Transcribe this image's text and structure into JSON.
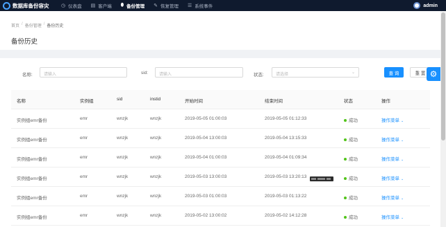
{
  "brand": {
    "name": "数据库备份容灾"
  },
  "nav": [
    {
      "label": "仪表盘",
      "icon": "dashboard-icon",
      "glyph": "◷"
    },
    {
      "label": "客户端",
      "icon": "client-icon",
      "glyph": "▤"
    },
    {
      "label": "备份管理",
      "icon": "backup-icon",
      "glyph": "⬮"
    },
    {
      "label": "恢复管理",
      "icon": "restore-icon",
      "glyph": "✎"
    },
    {
      "label": "系统事件",
      "icon": "events-icon",
      "glyph": "☰"
    }
  ],
  "active_nav": "备份管理",
  "user": {
    "name": "admin"
  },
  "breadcrumb": [
    "首页",
    "备份管理",
    "备份历史"
  ],
  "page_title": "备份历史",
  "filters": {
    "name_label": "名称:",
    "name_placeholder": "请输入",
    "sid_label": "sid:",
    "sid_placeholder": "请输入",
    "status_label": "状态:",
    "status_placeholder": "请选择",
    "query_label": "查 询",
    "reset_label": "重 置"
  },
  "table": {
    "columns": [
      "名称",
      "实例组",
      "sid",
      "instid",
      "开始时间",
      "结束时间",
      "状态",
      "操作"
    ],
    "rows": [
      {
        "name": "实例组emr备份",
        "group": "emr",
        "sid": "wnzjk",
        "instid": "wnzjk",
        "start": "2019-05-05 01:00:03",
        "end": "2019-05-05 01:12:33",
        "status": "成功",
        "op": "操作菜单"
      },
      {
        "name": "实例组emr备份",
        "group": "emr",
        "sid": "wnzjk",
        "instid": "wnzjk",
        "start": "2019-05-04 13:00:03",
        "end": "2019-05-04 13:15:33",
        "status": "成功",
        "op": "操作菜单"
      },
      {
        "name": "实例组emr备份",
        "group": "emr",
        "sid": "wnzjk",
        "instid": "wnzjk",
        "start": "2019-05-04 01:00:03",
        "end": "2019-05-04 01:09:34",
        "status": "成功",
        "op": "操作菜单"
      },
      {
        "name": "实例组emr备份",
        "group": "emr",
        "sid": "wnzjk",
        "instid": "wnzjk",
        "start": "2019-05-03 13:00:03",
        "end": "2019-05-03 13:20:13",
        "status": "成功",
        "op": "操作菜单"
      },
      {
        "name": "实例组emr备份",
        "group": "emr",
        "sid": "wnzjk",
        "instid": "wnzjk",
        "start": "2019-05-03 01:00:03",
        "end": "2019-05-03 01:13:22",
        "status": "成功",
        "op": "操作菜单"
      },
      {
        "name": "实例组emr备份",
        "group": "emr",
        "sid": "wnzjk",
        "instid": "wnzjk",
        "start": "2019-05-02 13:00:02",
        "end": "2019-05-02 14:12:28",
        "status": "成功",
        "op": "操作菜单"
      }
    ]
  },
  "colors": {
    "nav_bg": "#0f1a2e",
    "accent": "#1890ff",
    "success": "#52c41a"
  }
}
